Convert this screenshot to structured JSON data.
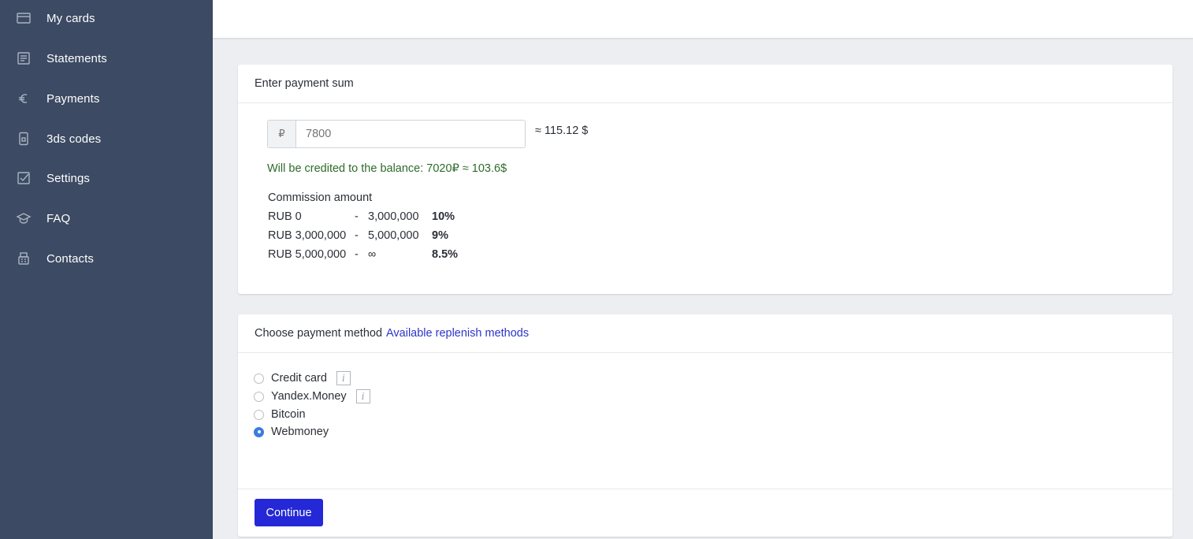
{
  "sidebar": {
    "items": [
      {
        "label": "My cards",
        "icon": "credit-card-icon"
      },
      {
        "label": "Statements",
        "icon": "document-list-icon"
      },
      {
        "label": "Payments",
        "icon": "euro-icon"
      },
      {
        "label": "3ds codes",
        "icon": "phone-icon"
      },
      {
        "label": "Settings",
        "icon": "checkbox-edit-icon"
      },
      {
        "label": "FAQ",
        "icon": "graduation-cap-icon"
      },
      {
        "label": "Contacts",
        "icon": "fax-icon"
      }
    ]
  },
  "payment_sum": {
    "header": "Enter payment sum",
    "currency_symbol": "₽",
    "amount_value": "",
    "amount_placeholder": "7800",
    "approx_usd": "≈ 115.12 $",
    "credited_text": "Will be credited to the balance: 7020₽ ≈ 103.6$",
    "commission_title": "Commission amount",
    "commission_rows": [
      {
        "from": "RUB 0",
        "dash": "-",
        "to": "3,000,000",
        "rate": "10%"
      },
      {
        "from": "RUB 3,000,000",
        "dash": "-",
        "to": "5,000,000",
        "rate": "9%"
      },
      {
        "from": "RUB 5,000,000",
        "dash": "-",
        "to": "∞",
        "rate": "8.5%"
      }
    ]
  },
  "payment_method": {
    "header": "Choose payment method",
    "header_link": "Available replenish methods",
    "info_glyph": "i",
    "methods": [
      {
        "label": "Credit card",
        "checked": false,
        "info": true
      },
      {
        "label": "Yandex.Money",
        "checked": false,
        "info": true
      },
      {
        "label": "Bitcoin",
        "checked": false,
        "info": false
      },
      {
        "label": "Webmoney",
        "checked": true,
        "info": false
      }
    ],
    "continue_label": "Continue"
  },
  "colors": {
    "sidebar_bg": "#3c4a63",
    "primary_button": "#2428d6",
    "link": "#2c35c9",
    "success_text": "#2e6b2a",
    "radio_checked": "#3d7be0"
  }
}
